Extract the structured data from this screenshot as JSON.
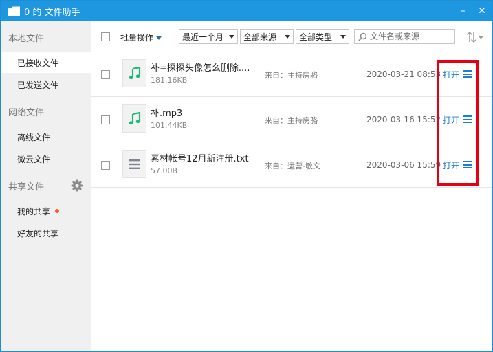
{
  "window": {
    "title": "0 的 文件助手",
    "minimize": "–",
    "close": "✕"
  },
  "sidebar": {
    "sections": [
      {
        "label": "本地文件",
        "items": [
          {
            "label": "已接收文件",
            "active": true
          },
          {
            "label": "已发送文件"
          }
        ]
      },
      {
        "label": "网络文件",
        "items": [
          {
            "label": "离线文件"
          },
          {
            "label": "微云文件"
          }
        ]
      },
      {
        "label": "共享文件",
        "items": [
          {
            "label": "我的共享",
            "badge": true
          },
          {
            "label": "好友的共享"
          }
        ]
      }
    ]
  },
  "toolbar": {
    "batch_label": "批量操作",
    "time_filter": "最近一个月",
    "source_filter": "全部来源",
    "type_filter": "全部类型",
    "search_placeholder": "文件名或来源"
  },
  "files": [
    {
      "name": "补=探探头像怎么删除....",
      "size": "181.16KB",
      "from": "来自：主持房骆",
      "date": "2020-03-21 08:53",
      "open": "打开",
      "icon": "music-note-icon"
    },
    {
      "name": "补.mp3",
      "size": "101.44KB",
      "from": "来自：主持房骆",
      "date": "2020-03-16 15:52",
      "open": "打开",
      "icon": "music-note-icon"
    },
    {
      "name": "素材帐号12月新注册.txt",
      "size": "57.00B",
      "from": "来自：运营-敏文",
      "date": "2020-03-06 15:59",
      "open": "打开",
      "icon": "text-file-icon"
    }
  ],
  "colors": {
    "titlebar": "#1e96e0",
    "accent": "#1a7fd0",
    "music_icon": "#1fb87a",
    "highlight": "#e60012",
    "badge": "#ff5a1f"
  }
}
